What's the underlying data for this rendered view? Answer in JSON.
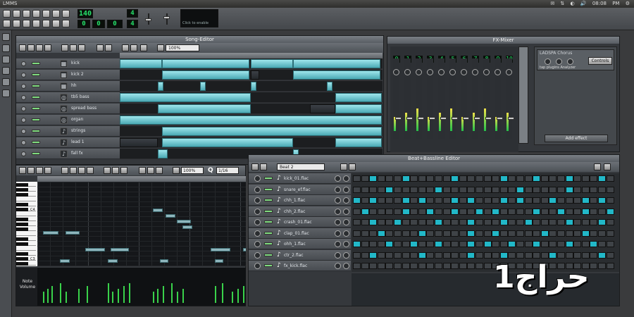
{
  "app": {
    "title": "LMMS"
  },
  "systray": {
    "clock": "08:08 PM"
  },
  "toolbar": {
    "tempo": "140",
    "time_display": [
      "0",
      "0",
      "0"
    ],
    "time_sig_num": "4",
    "time_sig_den": "4",
    "cpu_label": "Click to enable"
  },
  "song_editor": {
    "title": "Song-Editor",
    "zoom": "100%",
    "tracks": [
      {
        "name": "kick",
        "icon": "bb-track-icon"
      },
      {
        "name": "kick 2",
        "icon": "bb-track-icon"
      },
      {
        "name": "hh",
        "icon": "bb-track-icon"
      },
      {
        "name": "tb5 bass",
        "icon": "synth-icon"
      },
      {
        "name": "spread bass",
        "icon": "synth-icon"
      },
      {
        "name": "organ",
        "icon": "synth-icon"
      },
      {
        "name": "strings",
        "icon": "note-icon"
      },
      {
        "name": "lead 1",
        "icon": "note-icon"
      },
      {
        "name": "fall fx",
        "icon": "note-icon"
      }
    ]
  },
  "fx_mixer": {
    "title": "FX-Mixer",
    "channel_numbers": [
      "0",
      "1",
      "2",
      "3",
      "4",
      "5",
      "6",
      "7",
      "8",
      "9",
      "10"
    ],
    "effect_name": "LADSPA Chorus",
    "effect_desc": "tap plugins Analyzer",
    "controls_button": "Controls",
    "add_effect_button": "Add effect"
  },
  "piano_roll": {
    "zoom": "100%",
    "quantize": "1/16",
    "note_volume_label": "Note Volume",
    "octave_labels": [
      "C4",
      "C3"
    ]
  },
  "bb_editor": {
    "title": "Beat+Bassline Editor",
    "beat_selector": "Beat 2",
    "rows": [
      {
        "name": "kick_01.flac"
      },
      {
        "name": "snare_ef.flac"
      },
      {
        "name": "chh_1.flac"
      },
      {
        "name": "chh_2.flac"
      },
      {
        "name": "crash_01.flac"
      },
      {
        "name": "clap_01.flac"
      },
      {
        "name": "ohh_1.flac"
      },
      {
        "name": "ctr_2.flac"
      },
      {
        "name": "fx_kick.flac"
      }
    ],
    "patterns": [
      [
        0,
        0,
        1,
        0,
        0,
        0,
        1,
        0,
        0,
        0,
        0,
        0,
        1,
        0,
        0,
        0,
        0,
        0,
        1,
        0,
        0,
        0,
        1,
        0,
        0,
        0,
        1,
        0,
        0,
        0,
        1,
        0
      ],
      [
        0,
        0,
        0,
        0,
        1,
        0,
        0,
        0,
        0,
        0,
        1,
        0,
        0,
        0,
        0,
        0,
        0,
        0,
        0,
        0,
        1,
        0,
        0,
        0,
        0,
        0,
        1,
        0,
        0,
        0,
        0,
        0
      ],
      [
        1,
        0,
        1,
        0,
        0,
        0,
        1,
        0,
        1,
        0,
        0,
        0,
        1,
        0,
        1,
        0,
        0,
        0,
        1,
        0,
        1,
        0,
        0,
        0,
        1,
        0,
        0,
        0,
        1,
        0,
        1,
        0
      ],
      [
        0,
        1,
        0,
        0,
        0,
        0,
        1,
        0,
        0,
        1,
        0,
        0,
        1,
        0,
        0,
        1,
        0,
        1,
        0,
        0,
        0,
        0,
        1,
        0,
        0,
        1,
        0,
        0,
        1,
        0,
        0,
        1
      ],
      [
        0,
        0,
        1,
        0,
        0,
        1,
        0,
        0,
        0,
        0,
        1,
        0,
        0,
        0,
        1,
        0,
        0,
        0,
        1,
        0,
        0,
        1,
        0,
        0,
        0,
        0,
        1,
        0,
        0,
        0,
        1,
        0
      ],
      [
        0,
        0,
        0,
        1,
        0,
        0,
        0,
        0,
        1,
        0,
        0,
        0,
        0,
        0,
        1,
        0,
        0,
        1,
        0,
        0,
        0,
        0,
        0,
        1,
        0,
        0,
        0,
        0,
        1,
        0,
        0,
        0
      ],
      [
        1,
        0,
        0,
        0,
        1,
        0,
        0,
        1,
        0,
        0,
        1,
        0,
        0,
        0,
        1,
        0,
        1,
        0,
        0,
        1,
        0,
        0,
        1,
        0,
        0,
        0,
        1,
        0,
        0,
        1,
        0,
        0
      ],
      [
        0,
        0,
        1,
        0,
        0,
        0,
        0,
        0,
        1,
        0,
        0,
        0,
        0,
        0,
        1,
        0,
        0,
        0,
        1,
        0,
        0,
        0,
        0,
        0,
        1,
        0,
        0,
        0,
        0,
        0,
        1,
        0
      ],
      [
        0,
        0,
        0,
        0,
        0,
        0,
        0,
        0,
        0,
        0,
        0,
        0,
        0,
        0,
        0,
        0,
        0,
        0,
        0,
        0,
        0,
        0,
        0,
        0,
        0,
        0,
        0,
        0,
        0,
        0,
        0,
        0
      ]
    ]
  },
  "watermark": {
    "text": "حراج1"
  },
  "colors": {
    "accent": "#22b8c8",
    "clip": "#7fd0d8",
    "lcd": "#26e06a"
  }
}
